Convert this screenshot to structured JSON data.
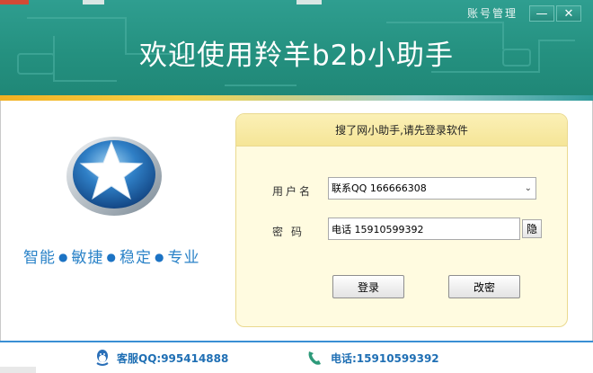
{
  "window": {
    "title": "欢迎使用羚羊b2b小助手",
    "account_link": "账号管理",
    "minimize_glyph": "—",
    "close_glyph": "✕"
  },
  "left": {
    "logo_icon": "star-globe-icon",
    "slogan": [
      "智能",
      "敏捷",
      "稳定",
      "专业"
    ],
    "slogan_separator": "●"
  },
  "login": {
    "heading": "搜了网小助手,请先登录软件",
    "username_label": "用户名",
    "username_value": "联系QQ 166666308",
    "password_label": "密码",
    "password_value": "电话 15910599392",
    "hide_button": "隐",
    "login_button": "登录",
    "change_button": "改密"
  },
  "footer": {
    "qq": "客服QQ:995414888",
    "phone": "电话:15910599392",
    "qq_icon": "qq-penguin-icon",
    "phone_icon": "phone-handset-icon"
  },
  "colors": {
    "header_teal": "#24907f",
    "accent_blue": "#2b83c8",
    "panel_bg": "#fffbe0"
  }
}
